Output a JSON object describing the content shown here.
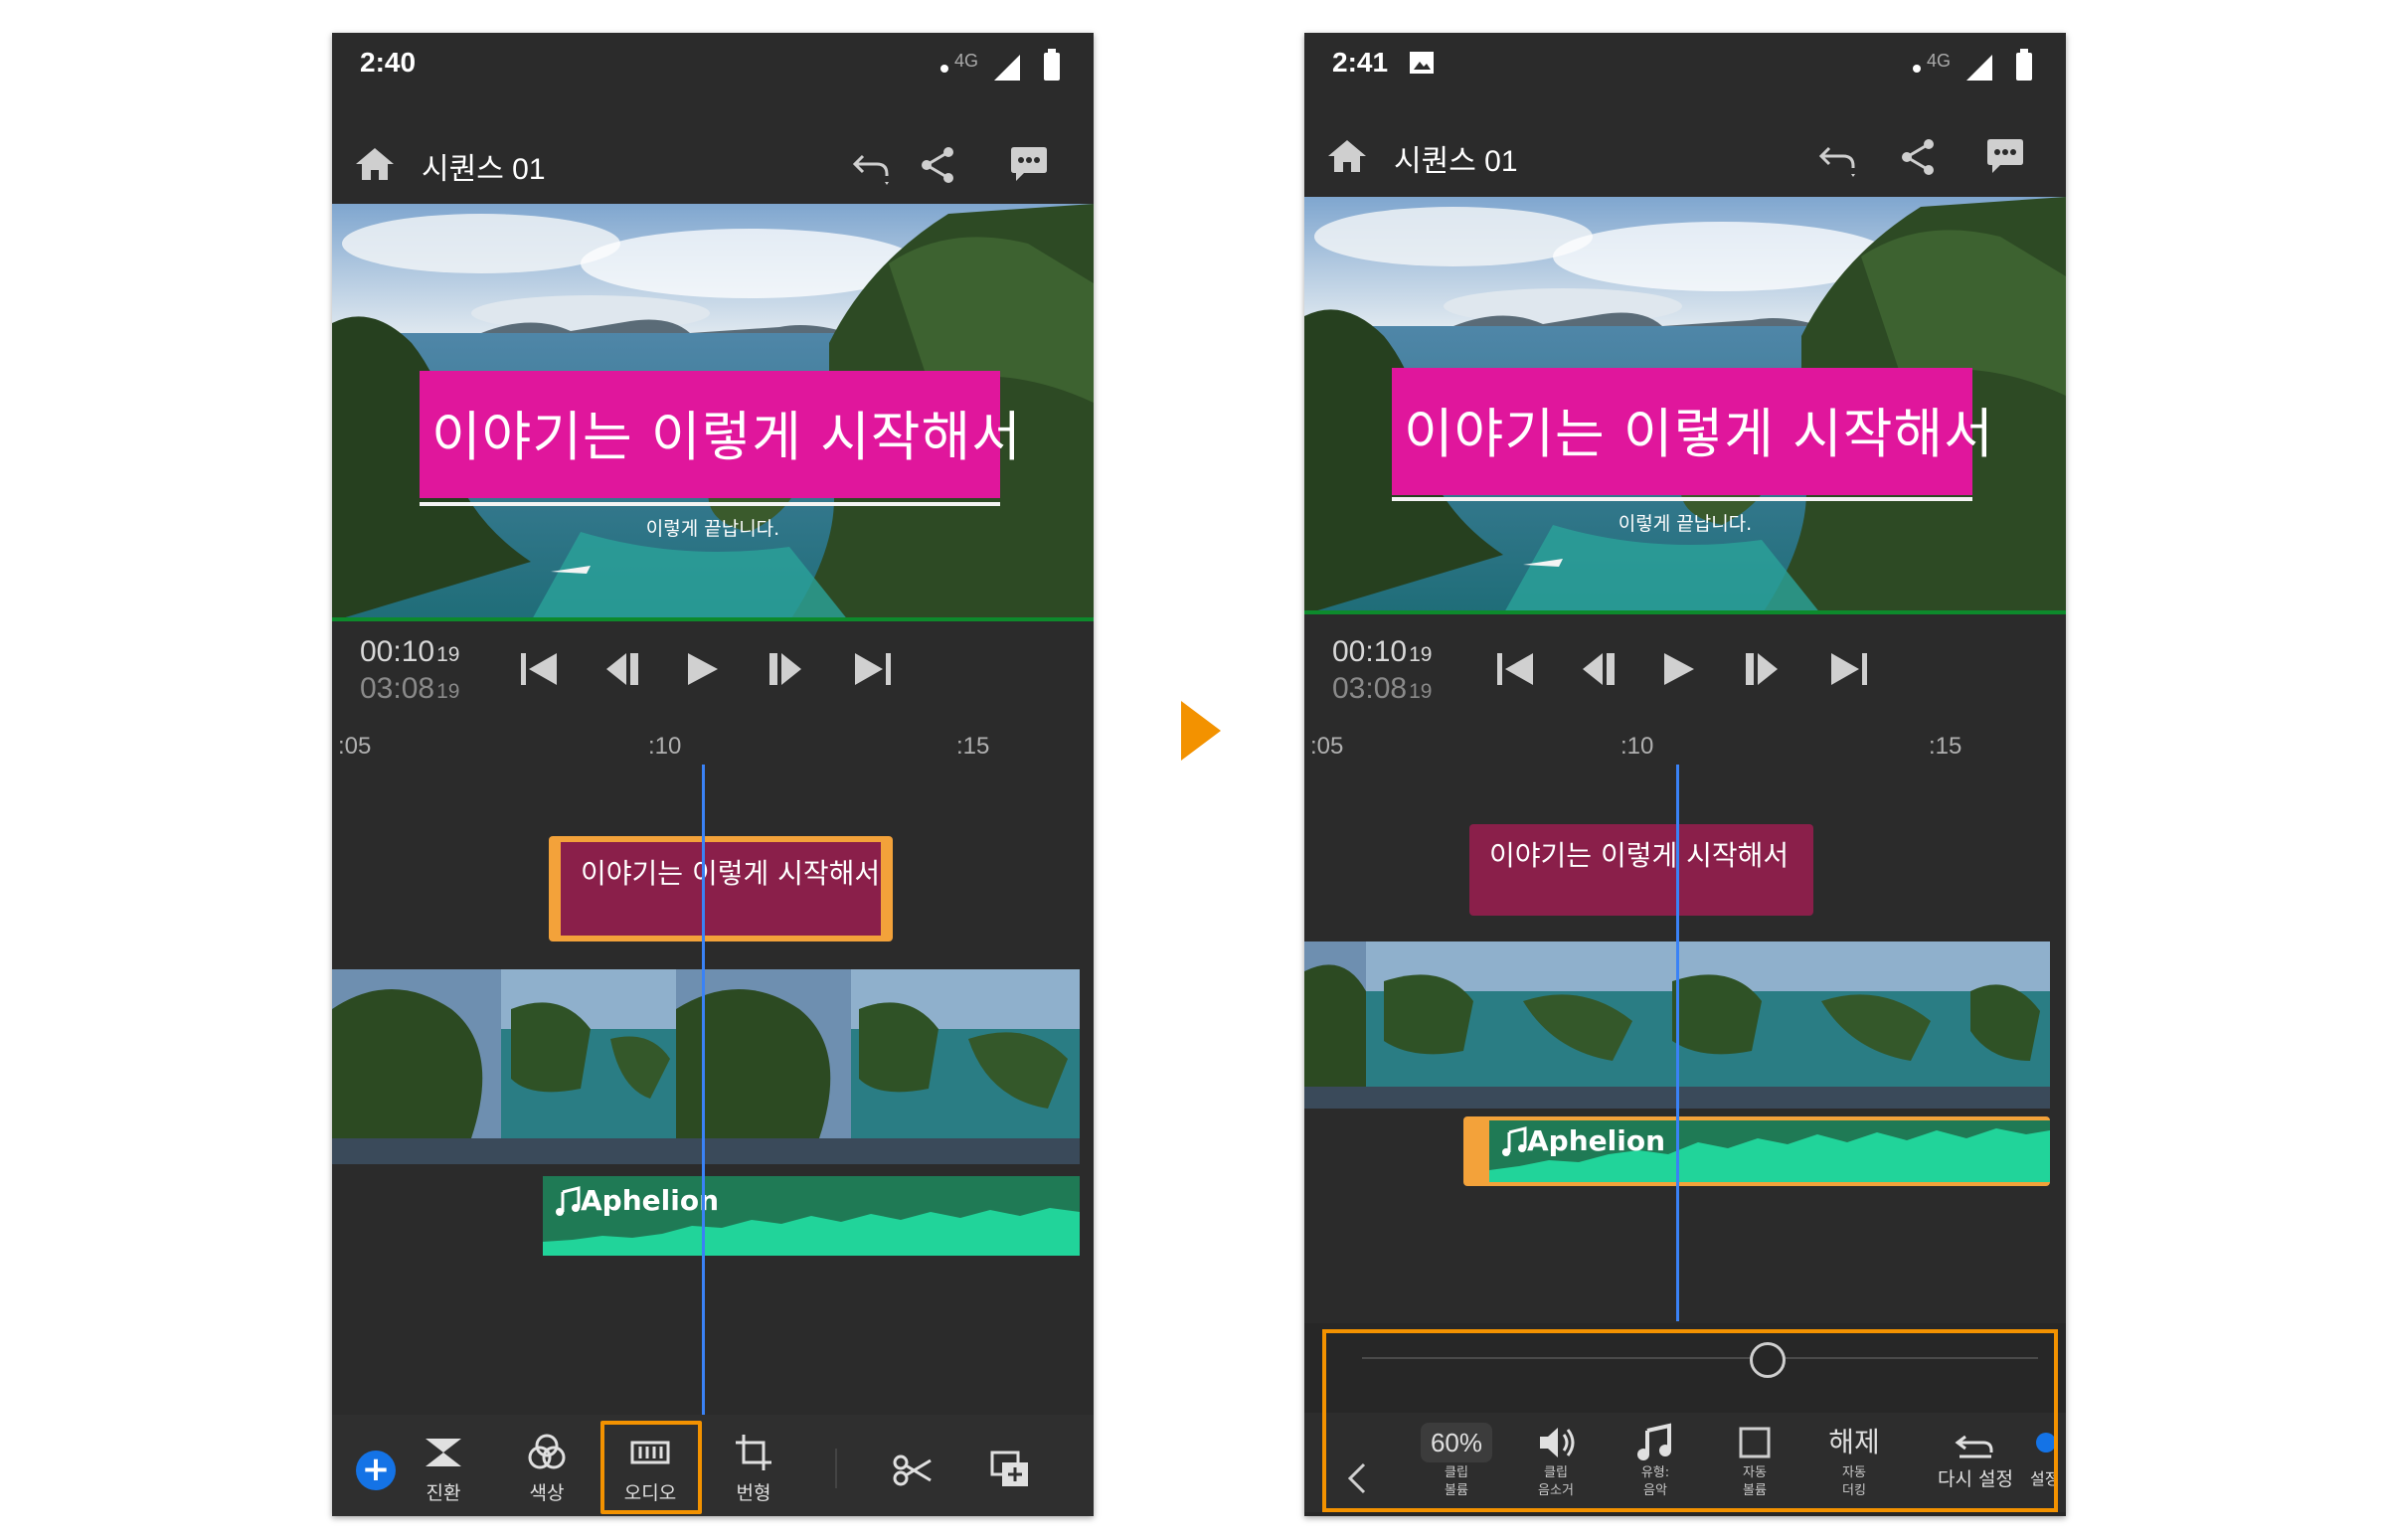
{
  "colors": {
    "accent_orange": "#f39200",
    "title_pink": "#e0169c",
    "clip_maroon": "#8a1f4a",
    "audio_green": "#1f7a55",
    "waveform": "#21d49a",
    "playhead_blue": "#3a82f6"
  },
  "left": {
    "status_time": "2:40",
    "network": "4G",
    "sequence_title": "시퀀스 01",
    "video_title": "이야기는 이렇게 시작해서",
    "video_subtitle": "이렇게 끝납니다.",
    "current_time": "00:10",
    "current_frames": "19",
    "duration_time": "03:08",
    "duration_frames": "19",
    "ruler": [
      ":05",
      ":10",
      ":15"
    ],
    "title_clip_text": "이야기는 이렇게 시작해서",
    "audio_clip_name": "Aphelion",
    "toolbar": [
      {
        "label": "진환",
        "icon": "transition-icon"
      },
      {
        "label": "색상",
        "icon": "color-icon"
      },
      {
        "label": "오디오",
        "icon": "audio-icon"
      },
      {
        "label": "번형",
        "icon": "transform-icon"
      }
    ]
  },
  "right": {
    "status_time": "2:41",
    "network": "4G",
    "sequence_title": "시퀀스 01",
    "video_title": "이야기는 이렇게 시작해서",
    "video_subtitle": "이렇게 끝납니다.",
    "current_time": "00:10",
    "current_frames": "19",
    "duration_time": "03:08",
    "duration_frames": "19",
    "ruler": [
      ":05",
      ":10",
      ":15"
    ],
    "title_clip_text": "이야기는 이렇게 시작해서",
    "audio_clip_name": "Aphelion",
    "volume_slider_level": 0.6,
    "settings": {
      "clip_volume_value": "60%",
      "clip_volume_label_1": "클립",
      "clip_volume_label_2": "볼륨",
      "mute_label_1": "클립",
      "mute_label_2": "음소거",
      "type_label_1": "유형:",
      "type_label_2": "음악",
      "auto_volume_label_1": "자동",
      "auto_volume_label_2": "볼륨",
      "ducking_value": "해제",
      "ducking_label_1": "자동",
      "ducking_label_2": "더킹",
      "reset_label": "다시 설정",
      "more_label": "설정"
    }
  }
}
